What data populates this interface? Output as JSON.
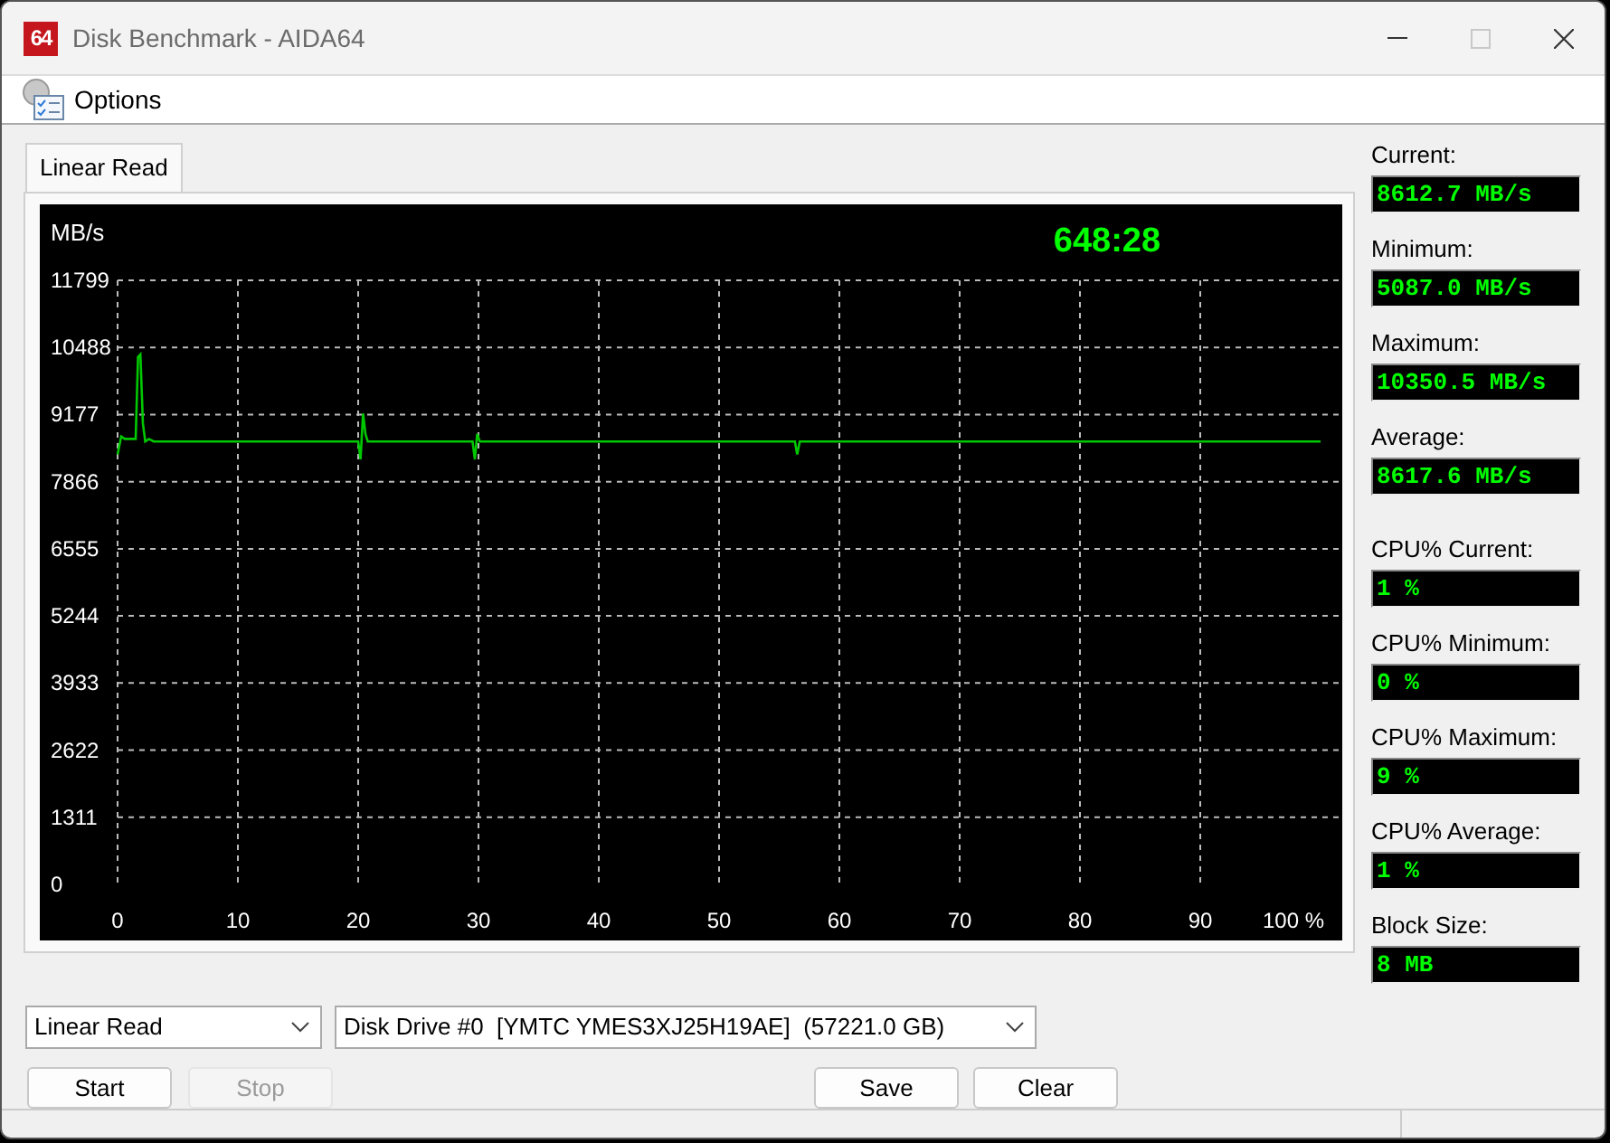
{
  "window": {
    "title": "Disk Benchmark - AIDA64",
    "app_icon_text": "64",
    "maximize_disabled": true
  },
  "menu": [
    {
      "label": "Options"
    }
  ],
  "tabs": [
    {
      "label": "Linear Read",
      "selected": true
    }
  ],
  "timer": "648:28",
  "chart": {
    "chart_data": {
      "type": "line",
      "grid": true,
      "ylabel": "MB/s",
      "xlim": [
        0,
        100
      ],
      "ylim": [
        0,
        11799
      ],
      "xticks": [
        0,
        10,
        20,
        30,
        40,
        50,
        60,
        70,
        80,
        90,
        {
          "value": 100,
          "label": "100 %"
        }
      ],
      "yticks": [
        0,
        1311,
        2622,
        3933,
        5244,
        6555,
        7866,
        9177,
        10488,
        11799
      ],
      "x": [
        0,
        0.3,
        0.6,
        1.5,
        1.7,
        1.9,
        2.1,
        2.3,
        2.6,
        3,
        20,
        20.2,
        20.4,
        20.6,
        20.8,
        21,
        29.5,
        29.7,
        29.9,
        30.1,
        30.3,
        56.3,
        56.5,
        56.7,
        100
      ],
      "series": [
        {
          "color": "#00c800",
          "values": [
            8400,
            8750,
            8700,
            8700,
            10300,
            10350,
            9000,
            8650,
            8700,
            8650,
            8650,
            8300,
            9200,
            8800,
            8650,
            8650,
            8650,
            8300,
            8800,
            8650,
            8650,
            8650,
            8400,
            8650,
            8650
          ]
        }
      ]
    }
  },
  "stats": [
    {
      "label": "Current:",
      "value": "8612.7 MB/s"
    },
    {
      "label": "Minimum:",
      "value": "5087.0 MB/s"
    },
    {
      "label": "Maximum:",
      "value": "10350.5 MB/s"
    },
    {
      "label": "Average:",
      "value": "8617.6 MB/s"
    },
    {
      "label": "CPU% Current:",
      "value": "1 %"
    },
    {
      "label": "CPU% Minimum:",
      "value": "0 %"
    },
    {
      "label": "CPU% Maximum:",
      "value": "9 %"
    },
    {
      "label": "CPU% Average:",
      "value": "1 %"
    },
    {
      "label": "Block Size:",
      "value": "8 MB"
    }
  ],
  "mode_select": {
    "value": "Linear Read"
  },
  "drive_select": {
    "value": "Disk Drive #0  [YMTC YMES3XJ25H19AE]  (57221.0 GB)"
  },
  "buttons": [
    {
      "label": "Start",
      "disabled": false
    },
    {
      "label": "Stop",
      "disabled": true
    },
    {
      "label": "Save",
      "disabled": false
    },
    {
      "label": "Clear",
      "disabled": false
    }
  ]
}
